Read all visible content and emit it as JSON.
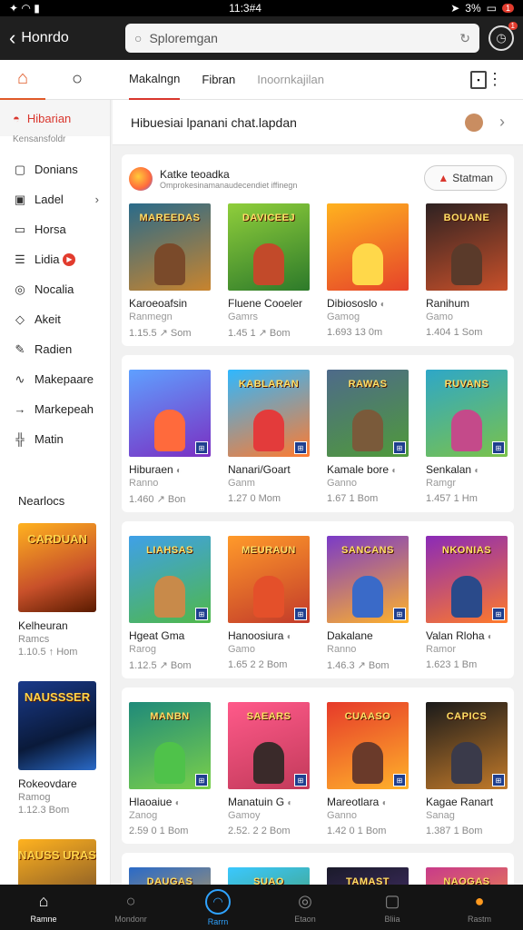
{
  "status": {
    "time": "11:3#4",
    "battery": "3%",
    "badge": "1"
  },
  "topbar": {
    "back_label": "Honrdo",
    "search_value": "Sploremgan",
    "notif_badge": "1"
  },
  "nav": {
    "tabs": [
      "Makalngn",
      "Fibran",
      "Inoornkajilan"
    ]
  },
  "sidebar": {
    "active": "Hibarian",
    "active_sub": "Kensansfoldr",
    "items": [
      {
        "label": "Donians",
        "icon": "bookmark-icon"
      },
      {
        "label": "Ladel",
        "icon": "tag-icon",
        "arrow": "›"
      },
      {
        "label": "Horsa",
        "icon": "monitor-icon"
      },
      {
        "label": "Lidia",
        "icon": "list-icon",
        "badge": "▶"
      },
      {
        "label": "Nocalia",
        "icon": "circle-icon"
      },
      {
        "label": "Akeit",
        "icon": "pin-icon"
      },
      {
        "label": "Radien",
        "icon": "edit-icon"
      },
      {
        "label": "Makepaare",
        "icon": "wave-icon"
      },
      {
        "label": "Markepeah",
        "icon": "arrow-icon"
      },
      {
        "label": "Matin",
        "icon": "grid-icon"
      }
    ],
    "section_title": "Nearlocs",
    "cards": [
      {
        "title": "CARDUAN",
        "name": "Kelheuran",
        "sub": "Ramcs",
        "meta": "1.10.5 ↑ Hom"
      },
      {
        "title": "NAUSSSER",
        "name": "Rokeovdare",
        "sub": "Ramog",
        "meta": "1.12.3 Bom"
      },
      {
        "title": "NAUSS URAS",
        "name": "",
        "sub": "",
        "meta": ""
      }
    ]
  },
  "main": {
    "banner": "Hibuesiai lpanani chat.lapdan",
    "section1": {
      "title": "Katke teoadka",
      "subtitle": "Omprokesinamanaudecendiet iffinegn",
      "button": "Statman"
    },
    "rows": [
      [
        {
          "title": "MAREEDAS",
          "name": "Karoeoafsin",
          "tag": "",
          "sub": "Ranmegn",
          "meta": "1.15.5 ↗ Som",
          "c1": "#2a6b8a",
          "c2": "#c8842e",
          "fig": "#7a4a2a"
        },
        {
          "title": "DAVICEEJ",
          "name": "Fluene Cooeler",
          "tag": "",
          "sub": "Gamrs",
          "meta": "1.45 1 ↗ Bom",
          "c1": "#8fce3b",
          "c2": "#2d7a2a",
          "fig": "#c24a2a"
        },
        {
          "title": "",
          "name": "Dibiososlo",
          "tag": "◐",
          "sub": "Gamog",
          "meta": "1.693 13 0m",
          "c1": "#ffb21f",
          "c2": "#e6432a",
          "fig": "#ffd84a"
        },
        {
          "title": "BOUANE",
          "name": "Ranihum",
          "tag": "",
          "sub": "Gamo",
          "meta": "1.404 1 Som",
          "c1": "#2e2222",
          "c2": "#c8502a",
          "fig": "#5a3a2a"
        }
      ],
      [
        {
          "title": "",
          "name": "Hiburaen",
          "tag": "◐",
          "sub": "Ranno",
          "meta": "1.460 ↗ Bon",
          "c1": "#5fa0ff",
          "c2": "#7a2fc2",
          "fig": "#ff6a3c"
        },
        {
          "title": "KABLARAN",
          "name": "Nanari/Goart",
          "tag": "",
          "sub": "Ganm",
          "meta": "1.27 0 Mom",
          "c1": "#2fb8ff",
          "c2": "#ff7a2f",
          "fig": "#e33b3b"
        },
        {
          "title": "RAWAS",
          "name": "Kamale bore",
          "tag": "◐",
          "sub": "Ganno",
          "meta": "1.67 1 Bom",
          "c1": "#4e6a8a",
          "c2": "#4f9a3a",
          "fig": "#7a5a3a"
        },
        {
          "title": "RUVANS",
          "name": "Senkalan",
          "tag": "◐",
          "sub": "Ramgr",
          "meta": "1.457 1 Hm",
          "c1": "#2ea7c8",
          "c2": "#7ac24a",
          "fig": "#c44a8a"
        }
      ],
      [
        {
          "title": "LIAHSAS",
          "name": "Hgeat Gma",
          "tag": "",
          "sub": "Rarog",
          "meta": "1.12.5 ↗ Bom",
          "c1": "#3fa0e8",
          "c2": "#4fb84a",
          "fig": "#c88a4a"
        },
        {
          "title": "MEURAUN",
          "name": "Hanoosiura",
          "tag": "◐",
          "sub": "Gamo",
          "meta": "1.65 2 2 Bom",
          "c1": "#ff9a2a",
          "c2": "#c23a2a",
          "fig": "#e4502a"
        },
        {
          "title": "SANCANS",
          "name": "Dakalane",
          "tag": "",
          "sub": "Ranno",
          "meta": "1.46.3 ↗ Bom",
          "c1": "#7a3ac8",
          "c2": "#ffb22a",
          "fig": "#3a6ac8"
        },
        {
          "title": "NKONIAS",
          "name": "Valan Rloha",
          "tag": "◐",
          "sub": "Ramor",
          "meta": "1.623 1 Bm",
          "c1": "#8a2ab8",
          "c2": "#ff7a2a",
          "fig": "#2a4a8a"
        }
      ],
      [
        {
          "title": "MANBN",
          "name": "Hlaoaiue",
          "tag": "◐",
          "sub": "Zanog",
          "meta": "2.59 0 1 Bom",
          "c1": "#1f8a7a",
          "c2": "#7ad04a",
          "fig": "#4fc24a"
        },
        {
          "title": "SAEARS",
          "name": "Manatuin G",
          "tag": "◐",
          "sub": "Gamoy",
          "meta": "2.52. 2 2 Bom",
          "c1": "#ff5a8a",
          "c2": "#c23a5a",
          "fig": "#3a2a2a"
        },
        {
          "title": "CUAASO",
          "name": "Mareotlara",
          "tag": "◐",
          "sub": "Ganno",
          "meta": "1.42 0 1 Bom",
          "c1": "#e63a2a",
          "c2": "#ffb22a",
          "fig": "#6a3a2a"
        },
        {
          "title": "CAPICS",
          "name": "Kagae Ranart",
          "tag": "",
          "sub": "Sanag",
          "meta": "1.387 1 Bom",
          "c1": "#1a1a1a",
          "c2": "#c27a2a",
          "fig": "#3a3a4a"
        }
      ],
      [
        {
          "title": "DAUGAS",
          "name": "",
          "tag": "",
          "sub": "",
          "meta": "",
          "c1": "#2a6ac8",
          "c2": "#ffb22a",
          "fig": "#e0502a"
        },
        {
          "title": "SUAO",
          "name": "",
          "tag": "",
          "sub": "",
          "meta": "",
          "c1": "#3ac8ff",
          "c2": "#4a8a2a",
          "fig": "#c88a4a"
        },
        {
          "title": "TAMAST",
          "name": "",
          "tag": "",
          "sub": "",
          "meta": "",
          "c1": "#1a1a2a",
          "c2": "#5a3a8a",
          "fig": "#3a2a2a"
        },
        {
          "title": "NAOGAS",
          "name": "",
          "tag": "",
          "sub": "",
          "meta": "",
          "c1": "#c83a8a",
          "c2": "#ffb22a",
          "fig": "#6a4a3a"
        }
      ]
    ]
  },
  "bottomnav": [
    {
      "label": "Ramne",
      "icon": "home-icon"
    },
    {
      "label": "Mondonr",
      "icon": "search-icon"
    },
    {
      "label": "Rarrn",
      "icon": "play-icon"
    },
    {
      "label": "Etaon",
      "icon": "user-icon"
    },
    {
      "label": "Bliia",
      "icon": "square-icon"
    },
    {
      "label": "Rastm",
      "icon": "person-icon"
    }
  ]
}
